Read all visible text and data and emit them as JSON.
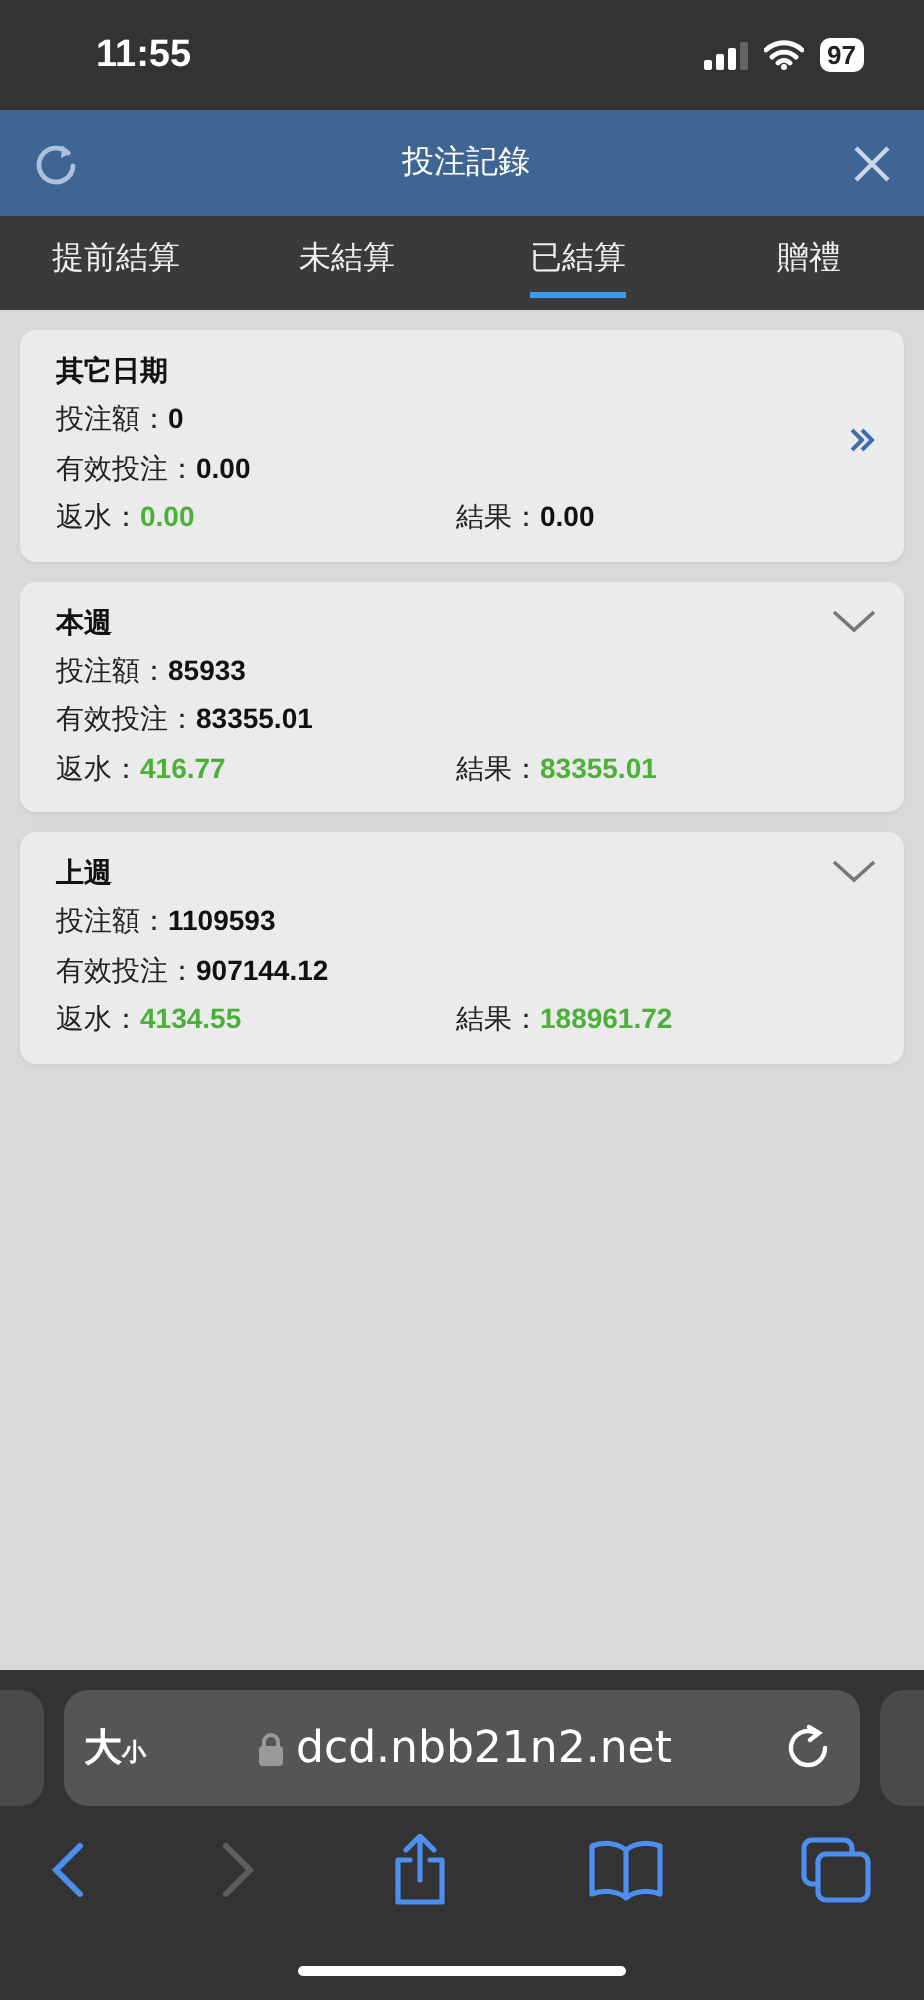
{
  "status_bar": {
    "time": "11:55",
    "battery": "97"
  },
  "header": {
    "title": "投注記錄"
  },
  "tabs": [
    {
      "label": "提前結算",
      "selected": false
    },
    {
      "label": "未結算",
      "selected": false
    },
    {
      "label": "已結算",
      "selected": true
    },
    {
      "label": "贈禮",
      "selected": false
    }
  ],
  "cards": [
    {
      "title": "其它日期",
      "kind": "link",
      "fields": [
        {
          "label": "投注額：",
          "value": "0",
          "highlighted": false
        },
        {
          "label": "有效投注：",
          "value": "0.00",
          "highlighted": false
        },
        {
          "label": "返水：",
          "value": "0.00",
          "highlighted": true
        },
        {
          "label": "結果：",
          "value": "0.00",
          "highlighted": false
        }
      ]
    },
    {
      "title": "本週",
      "kind": "collapse",
      "fields": [
        {
          "label": "投注額：",
          "value": "85933",
          "highlighted": false
        },
        {
          "label": "有效投注：",
          "value": "83355.01",
          "highlighted": false
        },
        {
          "label": "返水：",
          "value": "416.77",
          "highlighted": true
        },
        {
          "label": "結果：",
          "value": "83355.01",
          "highlighted": true
        }
      ]
    },
    {
      "title": "上週",
      "kind": "collapse",
      "fields": [
        {
          "label": "投注額：",
          "value": "1109593",
          "highlighted": false
        },
        {
          "label": "有效投注：",
          "value": "907144.12",
          "highlighted": false
        },
        {
          "label": "返水：",
          "value": "4134.55",
          "highlighted": true
        },
        {
          "label": "結果：",
          "value": "188961.72",
          "highlighted": true
        }
      ]
    }
  ],
  "browser": {
    "text_size": {
      "large": "大",
      "small": "小"
    },
    "url": "dcd.nbb21n2.net",
    "back": {
      "disabled": false
    },
    "forward": {
      "disabled": true
    }
  }
}
